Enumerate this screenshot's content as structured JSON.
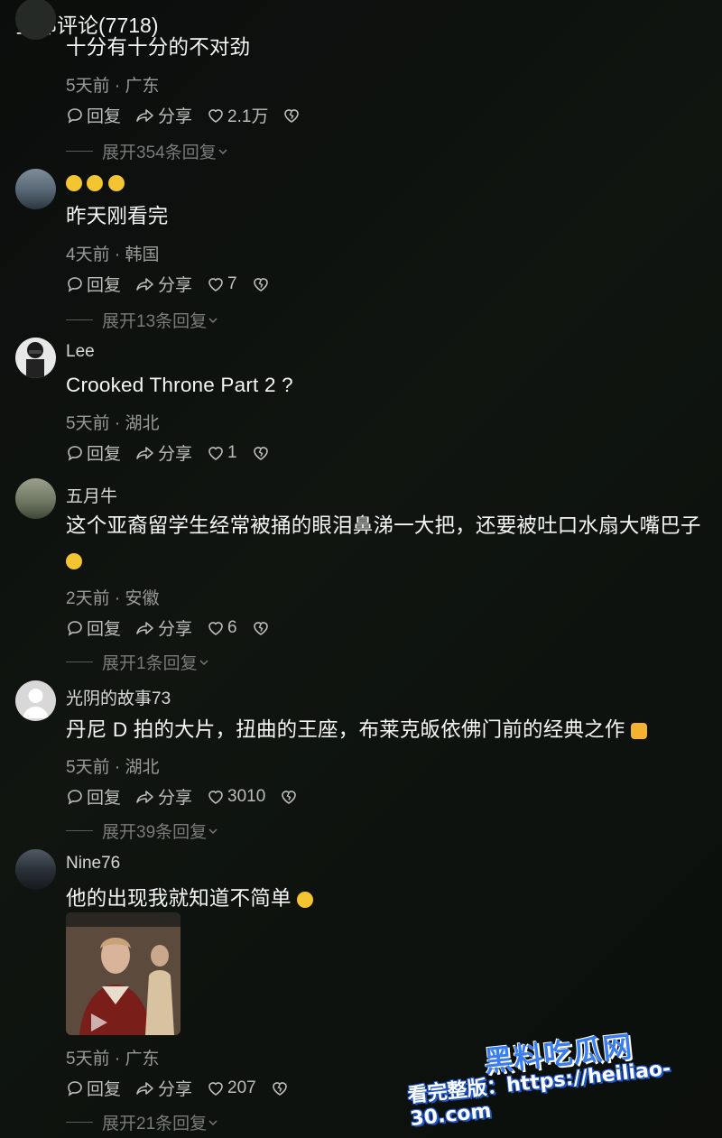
{
  "header": {
    "title": "全部评论(7718)"
  },
  "actions": {
    "reply": "回复",
    "share": "分享"
  },
  "comments": [
    {
      "username": "",
      "text": "十分有十分的不对劲",
      "meta": "5天前 · 广东",
      "likes": "2.1万",
      "expand": "展开354条回复"
    },
    {
      "username": "",
      "text": "昨天刚看完",
      "meta": "4天前 · 韩国",
      "likes": "7",
      "expand": "展开13条回复"
    },
    {
      "username": "Lee",
      "text": "Crooked Throne Part 2 ?",
      "meta": "5天前 · 湖北",
      "likes": "1",
      "expand": ""
    },
    {
      "username": "五月牛",
      "text": "这个亚裔留学生经常被捅的眼泪鼻涕一大把，还要被吐口水扇大嘴巴子",
      "meta": "2天前 · 安徽",
      "likes": "6",
      "expand": "展开1条回复"
    },
    {
      "username": "光阴的故事73",
      "text": "丹尼 D 拍的大片，扭曲的王座，布莱克皈依佛门前的经典之作",
      "meta": "5天前 · 湖北",
      "likes": "3010",
      "expand": "展开39条回复"
    },
    {
      "username": "Nine76",
      "text": "他的出现我就知道不简单",
      "meta": "5天前 · 广东",
      "likes": "207",
      "expand": "展开21条回复"
    }
  ],
  "watermark": {
    "logo": "黑料吃瓜网",
    "url": "看完整版：https://heiliao-30.com"
  }
}
